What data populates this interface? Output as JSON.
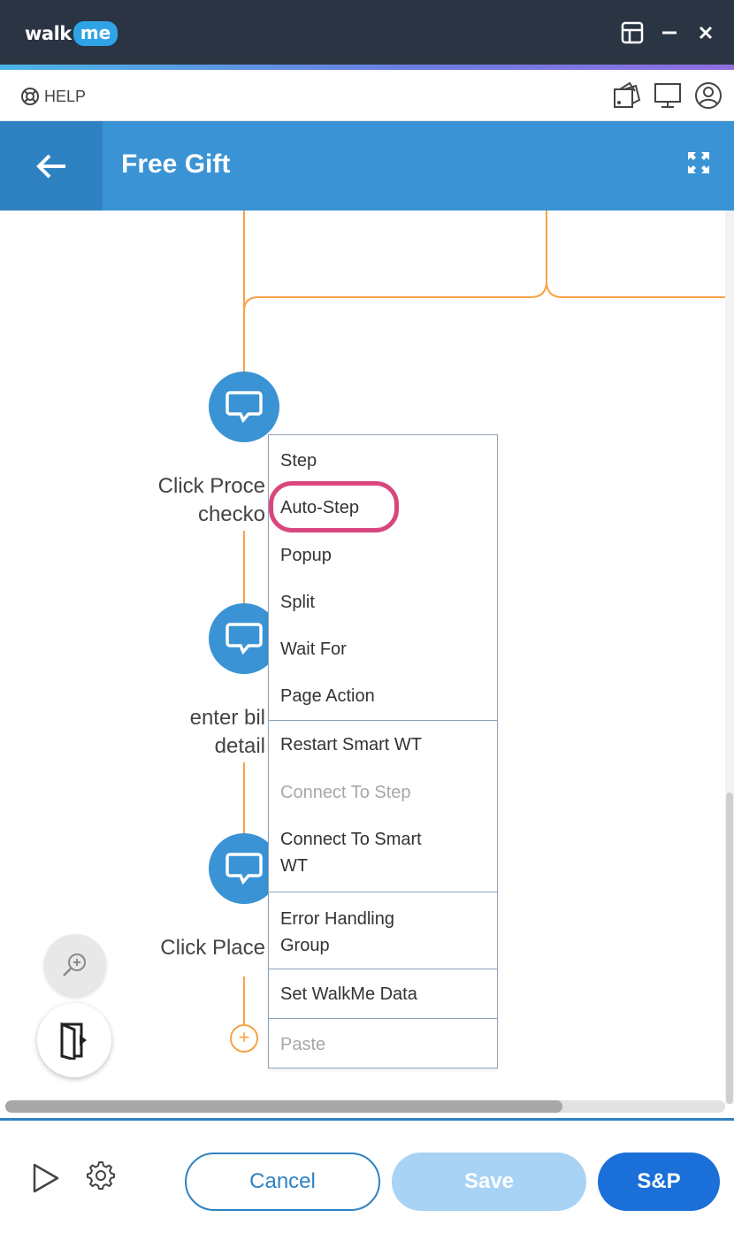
{
  "app": {
    "logo_walk": "walk",
    "logo_me": "me"
  },
  "helpbar": {
    "help_label": "HELP"
  },
  "header": {
    "title": "Free Gift"
  },
  "flow": {
    "nodes": [
      {
        "label_line1": "Click Proce",
        "label_line2": "checko"
      },
      {
        "label_line1": "enter bil",
        "label_line2": "detail"
      },
      {
        "label_line1": "Click Place",
        "label_line2": ""
      }
    ],
    "add_symbol": "+"
  },
  "context_menu": {
    "items": [
      {
        "label": "Step",
        "enabled": true
      },
      {
        "label": "Auto-Step",
        "enabled": true,
        "highlighted": true
      },
      {
        "label": "Popup",
        "enabled": true
      },
      {
        "label": "Split",
        "enabled": true
      },
      {
        "label": "Wait For",
        "enabled": true
      },
      {
        "label": "Page Action",
        "enabled": true
      },
      {
        "label": "Restart Smart WT",
        "enabled": true
      },
      {
        "label": "Connect To Step",
        "enabled": false
      },
      {
        "label_line1": "Connect To Smart",
        "label_line2": "WT",
        "enabled": true
      },
      {
        "label_line1": "Error Handling",
        "label_line2": "Group",
        "enabled": true
      },
      {
        "label": "Set WalkMe Data",
        "enabled": true
      },
      {
        "label": "Paste",
        "enabled": false
      }
    ]
  },
  "footer": {
    "cancel_label": "Cancel",
    "save_label": "Save",
    "sp_label": "S&P"
  },
  "colors": {
    "titlebar": "#2a3443",
    "header": "#3a93d4",
    "flow_line": "#f7a346",
    "highlight": "#d9467d",
    "primary": "#1a6fd8"
  },
  "icons": [
    "lifebuoy-icon",
    "palette-icon",
    "monitor-icon",
    "user-icon",
    "layout-icon",
    "minimize-icon",
    "close-icon",
    "back-arrow-icon",
    "expand-icon",
    "chat-bubble-icon",
    "zoom-in-icon",
    "exit-door-icon",
    "play-icon",
    "gear-icon"
  ]
}
